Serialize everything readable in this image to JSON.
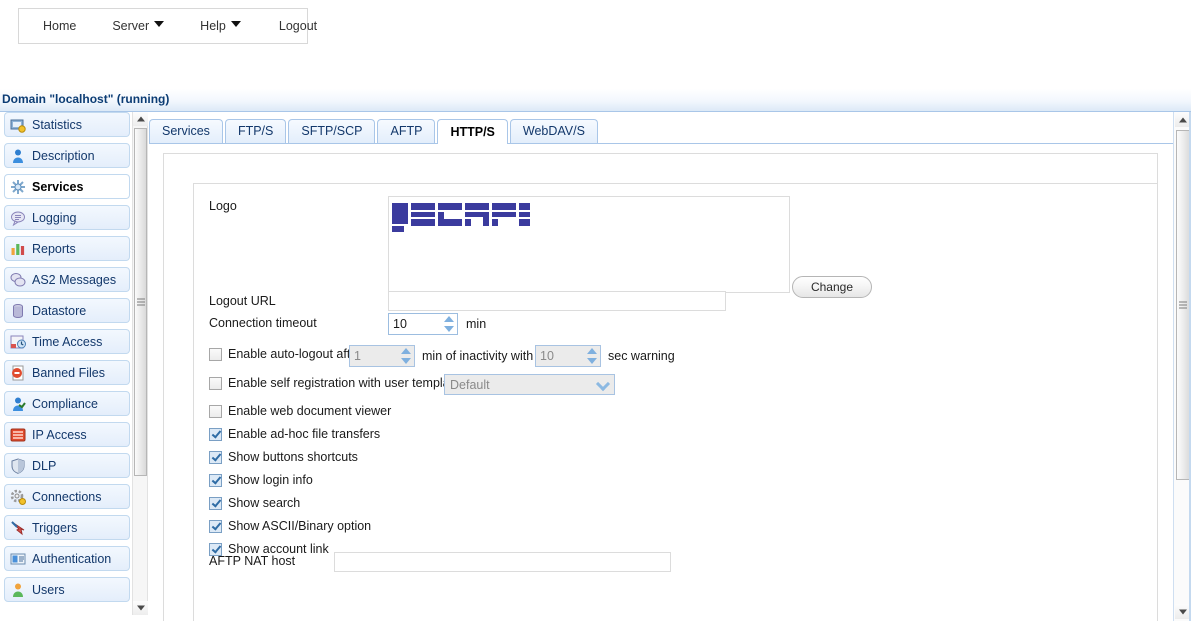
{
  "menubar": {
    "items": [
      {
        "label": "Home",
        "has_caret": false,
        "icon": null
      },
      {
        "label": "Server",
        "has_caret": true,
        "icon": "caret-down-icon"
      },
      {
        "label": "Help",
        "has_caret": true,
        "icon": "caret-down-icon"
      },
      {
        "label": "Logout",
        "has_caret": false,
        "icon": null
      }
    ]
  },
  "domain": {
    "title": "Domain \"localhost\" (running)"
  },
  "sidebar": {
    "items": [
      {
        "label": "Statistics",
        "icon": "statistics-icon",
        "selected": false
      },
      {
        "label": "Description",
        "icon": "description-icon",
        "selected": false
      },
      {
        "label": "Services",
        "icon": "services-icon",
        "selected": true
      },
      {
        "label": "Logging",
        "icon": "logging-icon",
        "selected": false
      },
      {
        "label": "Reports",
        "icon": "reports-icon",
        "selected": false
      },
      {
        "label": "AS2 Messages",
        "icon": "as2-messages-icon",
        "selected": false
      },
      {
        "label": "Datastore",
        "icon": "datastore-icon",
        "selected": false
      },
      {
        "label": "Time Access",
        "icon": "time-access-icon",
        "selected": false
      },
      {
        "label": "Banned Files",
        "icon": "banned-files-icon",
        "selected": false
      },
      {
        "label": "Compliance",
        "icon": "compliance-icon",
        "selected": false
      },
      {
        "label": "IP Access",
        "icon": "ip-access-icon",
        "selected": false
      },
      {
        "label": "DLP",
        "icon": "dlp-shield-icon",
        "selected": false
      },
      {
        "label": "Connections",
        "icon": "connections-icon",
        "selected": false
      },
      {
        "label": "Triggers",
        "icon": "triggers-icon",
        "selected": false
      },
      {
        "label": "Authentication",
        "icon": "authentication-icon",
        "selected": false
      },
      {
        "label": "Users",
        "icon": "users-icon",
        "selected": false
      }
    ]
  },
  "tabs": [
    {
      "label": "Services",
      "active": false
    },
    {
      "label": "FTP/S",
      "active": false
    },
    {
      "label": "SFTP/SCP",
      "active": false
    },
    {
      "label": "AFTP",
      "active": false
    },
    {
      "label": "HTTP/S",
      "active": true
    },
    {
      "label": "WebDAV/S",
      "active": false
    }
  ],
  "form": {
    "logo_label": "Logo",
    "logo_alt": "JSCAPE",
    "logo_color": "#3b3b9e",
    "change_button": "Change",
    "logout_url_label": "Logout URL",
    "logout_url_value": "",
    "connection_timeout_label": "Connection timeout",
    "connection_timeout_value": "10",
    "connection_timeout_unit": "min",
    "auto_logout": {
      "checked": false,
      "label_before": "Enable auto-logout after",
      "minutes_value": "1",
      "label_middle": "min of inactivity with",
      "seconds_value": "10",
      "label_after": "sec warning"
    },
    "self_registration": {
      "checked": false,
      "label": "Enable self registration with user template",
      "template_value": "Default"
    },
    "checkboxes": [
      {
        "label": "Enable web document viewer",
        "checked": false
      },
      {
        "label": "Enable ad-hoc file transfers",
        "checked": true
      },
      {
        "label": "Show buttons shortcuts",
        "checked": true
      },
      {
        "label": "Show login info",
        "checked": true
      },
      {
        "label": "Show search",
        "checked": true
      },
      {
        "label": "Show ASCII/Binary option",
        "checked": true
      },
      {
        "label": "Show account link",
        "checked": true
      }
    ],
    "aftp_nat_label": "AFTP NAT host",
    "aftp_nat_value": ""
  },
  "scrollbars": {
    "up_arrow_icon": "triangle-up-icon",
    "down_arrow_icon": "triangle-down-icon"
  }
}
